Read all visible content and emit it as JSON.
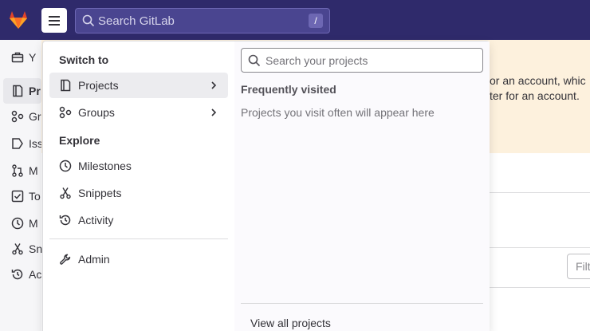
{
  "topbar": {
    "search_placeholder": "Search GitLab",
    "search_shortcut": "/"
  },
  "background": {
    "sidebar_items": [
      {
        "label": "Pr",
        "icon": "project-icon",
        "active": true
      },
      {
        "label": "Gr",
        "icon": "group-icon"
      },
      {
        "label": "Iss",
        "icon": "issues-icon"
      },
      {
        "label": "M",
        "icon": "merge-request-icon"
      },
      {
        "label": "To",
        "icon": "todo-icon"
      },
      {
        "label": "M",
        "icon": "milestone-icon"
      },
      {
        "label": "Sn",
        "icon": "snippet-icon"
      },
      {
        "label": "Ac",
        "icon": "activity-icon"
      }
    ],
    "top_label": "Y",
    "alert_line1": "or an account, whic",
    "alert_line2": "ter for an account.",
    "filter_placeholder": "Filt"
  },
  "menu": {
    "switch_to_title": "Switch to",
    "switch_items": [
      {
        "label": "Projects",
        "icon": "project-icon",
        "active": true
      },
      {
        "label": "Groups",
        "icon": "group-icon"
      }
    ],
    "explore_title": "Explore",
    "explore_items": [
      {
        "label": "Milestones",
        "icon": "clock-icon"
      },
      {
        "label": "Snippets",
        "icon": "scissors-icon"
      },
      {
        "label": "Activity",
        "icon": "history-icon"
      }
    ],
    "admin_label": "Admin",
    "projects_panel": {
      "search_placeholder": "Search your projects",
      "frequent_title": "Frequently visited",
      "empty_text": "Projects you visit often will appear here",
      "view_all": "View all projects"
    }
  }
}
